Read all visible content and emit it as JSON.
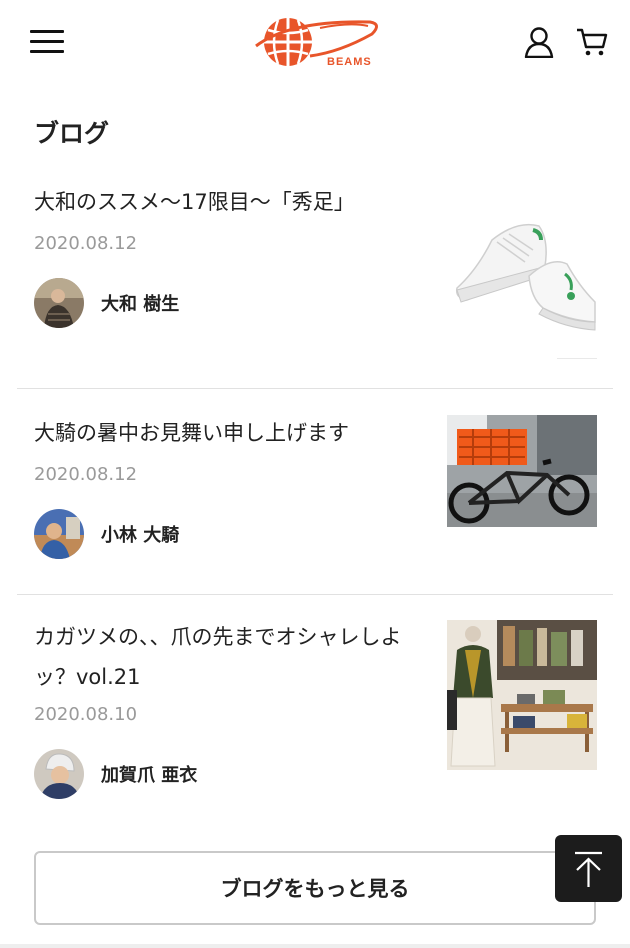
{
  "header": {
    "logo_text": "BEAMS",
    "menu_icon": "hamburger-menu-icon",
    "account_icon": "user-icon",
    "cart_icon": "cart-icon",
    "brand_color": "#e8552a"
  },
  "section": {
    "title": "ブログ"
  },
  "blog_posts": [
    {
      "title": "大和のススメ〜17限目〜「秀足」",
      "date": "2020.08.12",
      "author": "大和 樹生",
      "thumbnail": "white sneakers"
    },
    {
      "title": "大騎の暑中お見舞い申し上げます",
      "date": "2020.08.12",
      "author": "小林 大騎",
      "thumbnail": "bicycle with orange crate"
    },
    {
      "title": "カガツメの、、爪の先までオシャレしよッ？vol.21",
      "date": "2020.08.10",
      "author": "加賀爪 亜衣",
      "thumbnail": "store interior with outfit"
    }
  ],
  "more_button": {
    "label": "ブログをもっと見る"
  },
  "back_to_top_icon": "arrow-up-icon"
}
